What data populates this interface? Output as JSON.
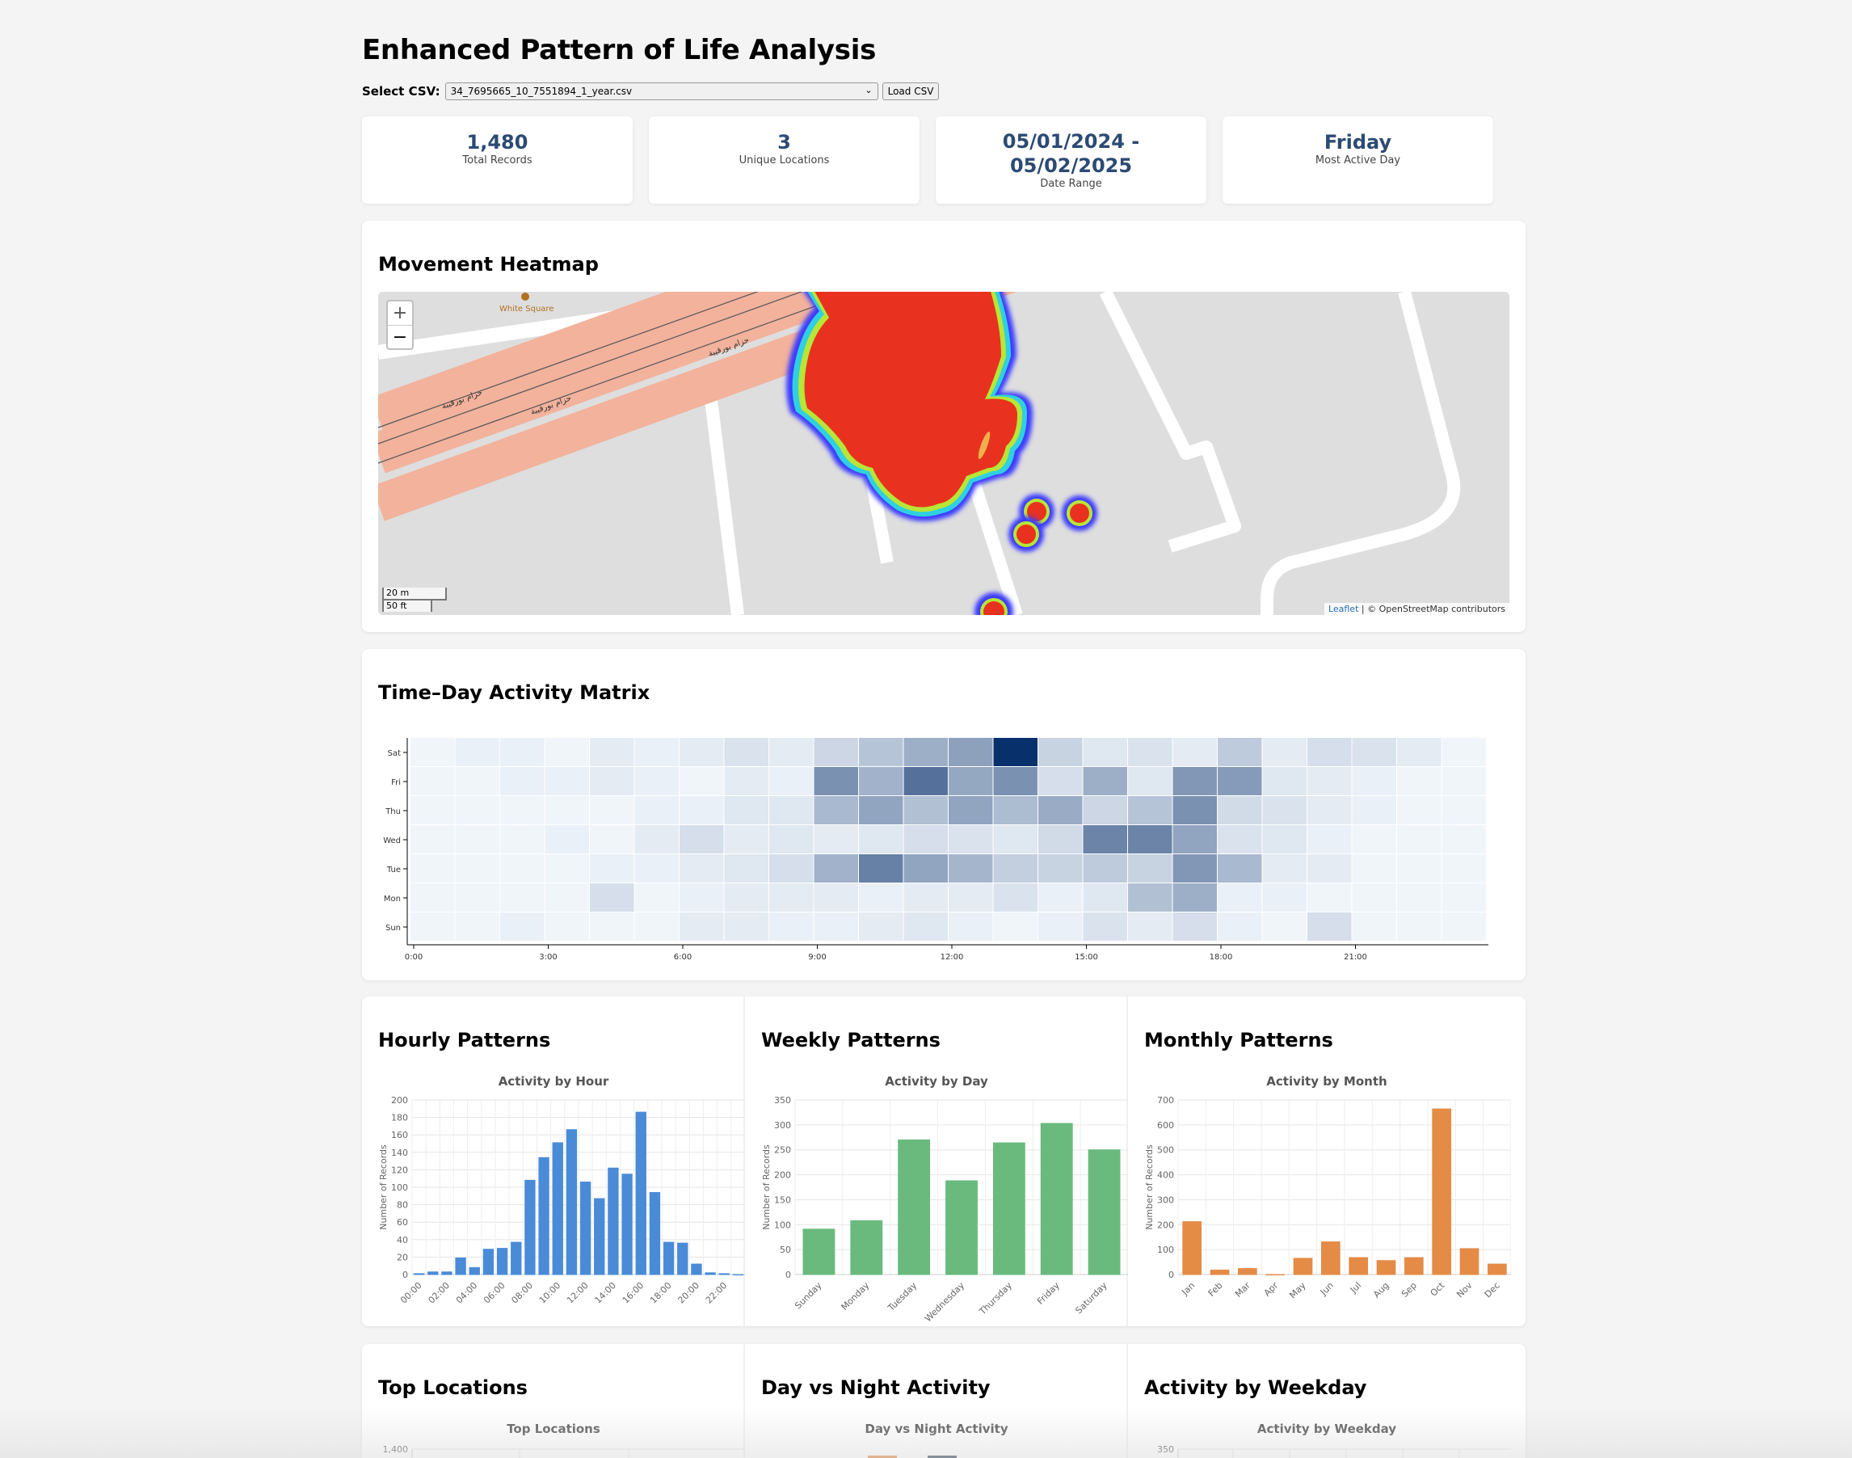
{
  "title": "Enhanced Pattern of Life Analysis",
  "csv": {
    "label": "Select CSV:",
    "selected": "34_7695665_10_7551894_1_year.csv",
    "load_label": "Load CSV"
  },
  "stats": [
    {
      "value": "1,480",
      "label": "Total Records"
    },
    {
      "value": "3",
      "label": "Unique Locations"
    },
    {
      "value": "05/01/2024 -\n05/02/2025",
      "value_line1": "05/01/2024 -",
      "value_line2": "05/02/2025",
      "label": "Date Range"
    },
    {
      "value": "Friday",
      "label": "Most Active Day"
    }
  ],
  "heatmap": {
    "title": "Movement Heatmap",
    "zoom_in": "+",
    "zoom_out": "−",
    "scale_m": "20 m",
    "scale_ft": "50 ft",
    "poi_label": "White Square",
    "road_labels": [
      "حزام بورقيبة",
      "حزام بورقيبة",
      "حزام بورقيبة"
    ],
    "attribution_link": "Leaflet",
    "attribution_text": " | © OpenStreetMap contributors",
    "colors": {
      "hot": "#e8321f",
      "road": "#f2b29c"
    }
  },
  "matrix": {
    "title": "Time–Day Activity Matrix",
    "days": [
      "Sat",
      "Fri",
      "Thu",
      "Wed",
      "Tue",
      "Mon",
      "Sun"
    ],
    "x_ticks": [
      "0:00",
      "3:00",
      "6:00",
      "9:00",
      "12:00",
      "15:00",
      "18:00",
      "21:00"
    ],
    "values": [
      [
        1,
        2,
        2,
        1,
        3,
        2,
        3,
        5,
        3,
        8,
        13,
        19,
        23,
        60,
        9,
        4,
        5,
        3,
        11,
        3,
        6,
        5,
        3,
        1
      ],
      [
        1,
        1,
        2,
        2,
        3,
        2,
        1,
        3,
        2,
        28,
        18,
        38,
        21,
        28,
        6,
        19,
        4,
        26,
        25,
        4,
        3,
        2,
        1,
        1
      ],
      [
        1,
        1,
        1,
        1,
        1,
        2,
        2,
        4,
        4,
        16,
        22,
        14,
        22,
        15,
        20,
        8,
        13,
        28,
        7,
        5,
        3,
        2,
        1,
        1
      ],
      [
        1,
        1,
        1,
        2,
        1,
        3,
        6,
        3,
        4,
        3,
        4,
        6,
        5,
        4,
        7,
        32,
        32,
        22,
        5,
        4,
        2,
        1,
        1,
        1
      ],
      [
        1,
        1,
        1,
        1,
        2,
        2,
        3,
        4,
        6,
        18,
        33,
        22,
        17,
        10,
        9,
        11,
        9,
        26,
        16,
        3,
        3,
        1,
        1,
        1
      ],
      [
        1,
        1,
        1,
        1,
        6,
        1,
        2,
        3,
        3,
        3,
        2,
        3,
        3,
        5,
        2,
        4,
        14,
        19,
        2,
        2,
        1,
        1,
        1,
        1
      ],
      [
        1,
        1,
        2,
        1,
        1,
        1,
        3,
        3,
        2,
        2,
        3,
        4,
        2,
        1,
        2,
        5,
        3,
        6,
        2,
        1,
        6,
        1,
        1,
        1
      ]
    ],
    "color_scale": [
      "#f7fbff",
      "#08306b"
    ]
  },
  "charts_row1": [
    {
      "section_title": "Hourly Patterns",
      "chart_data": {
        "type": "bar",
        "title": "Activity by Hour",
        "ylabel": "Number of Records",
        "xlabel": "",
        "categories": [
          "00:00",
          "01:00",
          "02:00",
          "03:00",
          "04:00",
          "05:00",
          "06:00",
          "07:00",
          "08:00",
          "09:00",
          "10:00",
          "11:00",
          "12:00",
          "13:00",
          "14:00",
          "15:00",
          "16:00",
          "17:00",
          "18:00",
          "19:00",
          "20:00",
          "21:00",
          "22:00",
          "23:00"
        ],
        "tick_labels": [
          "00:00",
          "02:00",
          "04:00",
          "06:00",
          "08:00",
          "10:00",
          "12:00",
          "14:00",
          "16:00",
          "18:00",
          "20:00",
          "22:00"
        ],
        "values": [
          1,
          3,
          3,
          19,
          8,
          29,
          30,
          37,
          108,
          134,
          151,
          166,
          106,
          87,
          122,
          115,
          186,
          94,
          37,
          36,
          12,
          2,
          1,
          0
        ],
        "ylim": [
          0,
          200
        ],
        "yticks": [
          0,
          20,
          40,
          60,
          80,
          100,
          120,
          140,
          160,
          180,
          200
        ],
        "color": "#4a8bd8",
        "grid": true
      }
    },
    {
      "section_title": "Weekly Patterns",
      "chart_data": {
        "type": "bar",
        "title": "Activity by Day",
        "ylabel": "Number of Records",
        "xlabel": "",
        "categories": [
          "Sunday",
          "Monday",
          "Tuesday",
          "Wednesday",
          "Thursday",
          "Friday",
          "Saturday"
        ],
        "tick_labels": [
          "Sunday",
          "Monday",
          "Tuesday",
          "Wednesday",
          "Thursday",
          "Friday",
          "Saturday"
        ],
        "values": [
          91,
          108,
          270,
          188,
          264,
          303,
          250
        ],
        "ylim": [
          0,
          350
        ],
        "yticks": [
          0,
          50,
          100,
          150,
          200,
          250,
          300,
          350
        ],
        "color": "#6aba7e",
        "grid": true
      }
    },
    {
      "section_title": "Monthly Patterns",
      "chart_data": {
        "type": "bar",
        "title": "Activity by Month",
        "ylabel": "Number of Records",
        "xlabel": "",
        "categories": [
          "Jan",
          "Feb",
          "Mar",
          "Apr",
          "May",
          "Jun",
          "Jul",
          "Aug",
          "Sep",
          "Oct",
          "Nov",
          "Dec"
        ],
        "tick_labels": [
          "Jan",
          "Feb",
          "Mar",
          "Apr",
          "May",
          "Jun",
          "Jul",
          "Aug",
          "Sep",
          "Oct",
          "Nov",
          "Dec"
        ],
        "values": [
          212,
          18,
          24,
          0,
          65,
          131,
          68,
          56,
          68,
          664,
          104,
          42
        ],
        "ylim": [
          0,
          700
        ],
        "yticks": [
          0,
          100,
          200,
          300,
          400,
          500,
          600,
          700
        ],
        "color": "#e48b46",
        "grid": true
      }
    }
  ],
  "charts_row2": [
    {
      "section_title": "Top Locations",
      "chart_title": "Top Locations",
      "first_tick": "1,400"
    },
    {
      "section_title": "Day vs Night Activity",
      "chart_title": "Day vs Night Activity",
      "first_tick": ""
    },
    {
      "section_title": "Activity by Weekday",
      "chart_title": "Activity by Weekday",
      "first_tick": "350"
    }
  ]
}
